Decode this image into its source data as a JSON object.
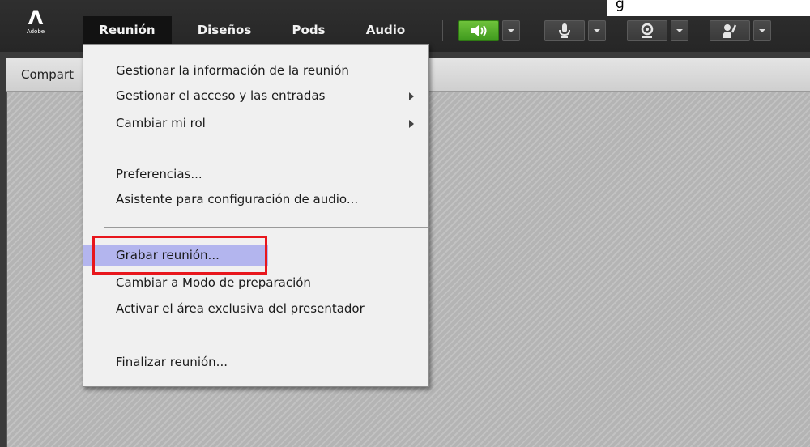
{
  "window": {
    "logo_text": "Adobe",
    "top_right_fragment": "g"
  },
  "menubar": {
    "items": [
      {
        "label": "Reunión",
        "active": true
      },
      {
        "label": "Diseños",
        "active": false
      },
      {
        "label": "Pods",
        "active": false
      },
      {
        "label": "Audio",
        "active": false
      }
    ]
  },
  "toolbar": {
    "icons": [
      "speaker-icon",
      "microphone-icon",
      "webcam-icon",
      "raise-hand-icon"
    ],
    "accent_green": "#5cb82e"
  },
  "pod": {
    "title": "Compart"
  },
  "dropdown": {
    "groups": [
      [
        {
          "label": "Gestionar la información de la reunión",
          "submenu": false
        },
        {
          "label": "Gestionar el acceso y las entradas",
          "submenu": true
        },
        {
          "label": "Cambiar mi rol",
          "submenu": true
        }
      ],
      [
        {
          "label": "Preferencias...",
          "submenu": false
        },
        {
          "label": "Asistente para configuración de audio...",
          "submenu": false
        }
      ],
      [
        {
          "label": "Grabar reunión...",
          "submenu": false,
          "highlighted": true
        },
        {
          "label": "Cambiar a Modo de preparación",
          "submenu": false
        },
        {
          "label": "Activar el área exclusiva del presentador",
          "submenu": false
        }
      ],
      [
        {
          "label": "Finalizar reunión...",
          "submenu": false
        }
      ]
    ],
    "highlight_color": "#b3b5ee",
    "annotation_border_color": "#e8161c"
  }
}
